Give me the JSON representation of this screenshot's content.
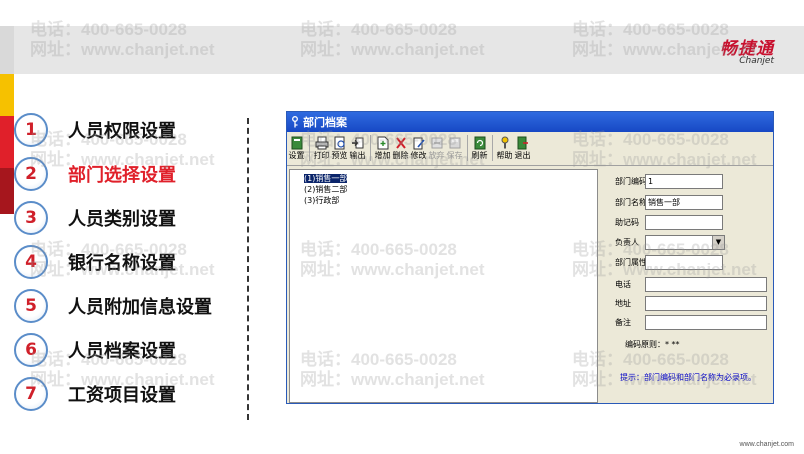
{
  "brand": {
    "name_cn": "畅捷通",
    "name_en": "Chanjet",
    "footer_url": "www.chanjet.com",
    "accent": "#c8102e"
  },
  "watermark": {
    "phone": "电话：400-665-0028",
    "site": "网址：www.chanjet.net"
  },
  "menu": {
    "items": [
      {
        "num": "1",
        "label": "人员权限设置",
        "active": false
      },
      {
        "num": "2",
        "label": "部门选择设置",
        "active": true
      },
      {
        "num": "3",
        "label": "人员类别设置",
        "active": false
      },
      {
        "num": "4",
        "label": "银行名称设置",
        "active": false
      },
      {
        "num": "5",
        "label": "人员附加信息设置",
        "active": false
      },
      {
        "num": "6",
        "label": "人员档案设置",
        "active": false
      },
      {
        "num": "7",
        "label": "工资项目设置",
        "active": false
      }
    ]
  },
  "window": {
    "title": "部门档案",
    "toolbar": [
      {
        "label": "设置",
        "icon": "settings-icon",
        "enabled": true
      },
      {
        "label": "打印",
        "icon": "print-icon",
        "enabled": true
      },
      {
        "label": "预览",
        "icon": "preview-icon",
        "enabled": true
      },
      {
        "label": "输出",
        "icon": "export-icon",
        "enabled": true
      },
      {
        "label": "增加",
        "icon": "add-icon",
        "enabled": true
      },
      {
        "label": "删除",
        "icon": "delete-icon",
        "enabled": true
      },
      {
        "label": "修改",
        "icon": "edit-icon",
        "enabled": true
      },
      {
        "label": "放弃",
        "icon": "discard-icon",
        "enabled": false
      },
      {
        "label": "保存",
        "icon": "save-icon",
        "enabled": false
      },
      {
        "label": "刷新",
        "icon": "refresh-icon",
        "enabled": true
      },
      {
        "label": "帮助",
        "icon": "help-icon",
        "enabled": true
      },
      {
        "label": "退出",
        "icon": "exit-icon",
        "enabled": true
      }
    ],
    "tree": [
      {
        "label": "(1)销售一部",
        "selected": true
      },
      {
        "label": "(2)销售二部",
        "selected": false
      },
      {
        "label": "(3)行政部",
        "selected": false
      }
    ],
    "form": {
      "dept_code_label": "部门编码",
      "dept_code_value": "1",
      "dept_name_label": "部门名称",
      "dept_name_value": "销售一部",
      "mnemonic_label": "助记码",
      "mnemonic_value": "",
      "manager_label": "负责人",
      "manager_value": "",
      "attribute_label": "部门属性",
      "attribute_value": "",
      "phone_label": "电话",
      "phone_value": "",
      "address_label": "地址",
      "address_value": "",
      "remark_label": "备注",
      "remark_value": "",
      "code_rule": "编码原则：* **",
      "tip": "提示：部门编码和部门名称为必录项。"
    }
  }
}
